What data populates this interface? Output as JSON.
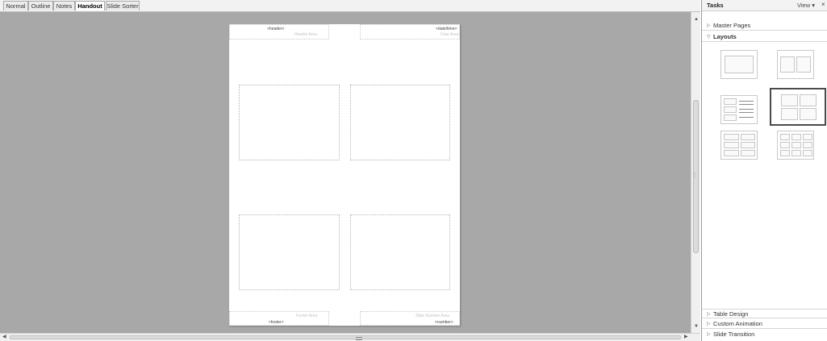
{
  "tabs": [
    {
      "label": "Normal",
      "active": false
    },
    {
      "label": "Outline",
      "active": false
    },
    {
      "label": "Notes",
      "active": false
    },
    {
      "label": "Handout",
      "active": true
    },
    {
      "label": "Slide Sorter",
      "active": false
    }
  ],
  "handout": {
    "header": "<header>",
    "header_area": "Header Area",
    "date_time": "<date/time>",
    "date_area": "Date Area",
    "footer": "<footer>",
    "footer_area": "Footer Area",
    "number": "<number>",
    "number_area": "Slide Number Area"
  },
  "task_pane": {
    "title": "Tasks",
    "view_menu": "View",
    "view_menu_arrow": "▾",
    "close": "×",
    "sections": {
      "master_pages": "Master Pages",
      "layouts": "Layouts",
      "table_design": "Table Design",
      "custom_animation": "Custom Animation",
      "slide_transition": "Slide Transition"
    },
    "layouts": [
      {
        "name": "one-slide",
        "selected": false
      },
      {
        "name": "two-slides",
        "selected": false
      },
      {
        "name": "three-slides-with-lines",
        "selected": false
      },
      {
        "name": "four-slides",
        "selected": true
      },
      {
        "name": "six-slides",
        "selected": false
      },
      {
        "name": "nine-slides",
        "selected": false
      }
    ]
  },
  "colors": {
    "workspace_bg": "#a8a8a8",
    "selection_border": "#4a4a4a"
  }
}
